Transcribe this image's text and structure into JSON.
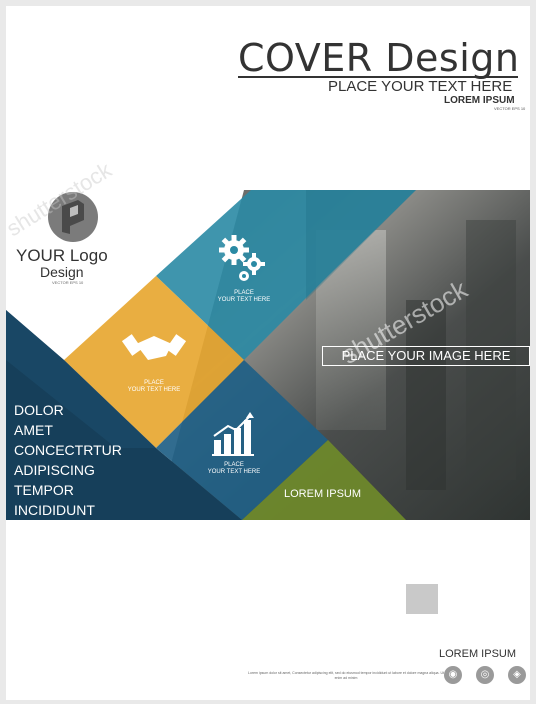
{
  "header": {
    "title": "COVER Design",
    "subtitle": "PLACE YOUR TEXT HERE",
    "subtitle2": "LOREM IPSUM",
    "vector_note": "VECTOR EPS 10"
  },
  "logo": {
    "name": "YOUR Logo",
    "design": "Design",
    "vector_note": "VECTOR EPS 10"
  },
  "banner": {
    "place_image": "PLACE YOUR IMAGE HERE",
    "lorem": "LOREM IPSUM",
    "list": [
      "DOLOR",
      "AMET",
      "CONCECTRTUR",
      "ADIPISCING",
      "TEMPOR",
      "INCIDIDUNT"
    ],
    "diamonds": [
      {
        "icon": "gears-icon",
        "label_line1": "PLACE",
        "label_line2": "YOUR TEXT HERE"
      },
      {
        "icon": "handshake-icon",
        "label_line1": "PLACE",
        "label_line2": "YOUR TEXT HERE"
      },
      {
        "icon": "growth-chart-icon",
        "label_line1": "PLACE",
        "label_line2": "YOUR TEXT HERE"
      }
    ]
  },
  "watermark": {
    "text": "shutterstock"
  },
  "footer": {
    "lorem": "LOREM IPSUM",
    "small_text": "Lorem ipsum dolor sit amet, Consectetur adipiscing elit, sed do eiusmod tempor incididunt ut labore et dolore magna aliqua. Ut enim ad minim",
    "social_icons": [
      "social-icon-1",
      "social-icon-2",
      "social-icon-3"
    ]
  },
  "colors": {
    "teal": "#2a8aa4",
    "gold": "#e7a52c",
    "navy": "#163f5a",
    "olive": "#6f8a2a",
    "text": "#333333"
  }
}
